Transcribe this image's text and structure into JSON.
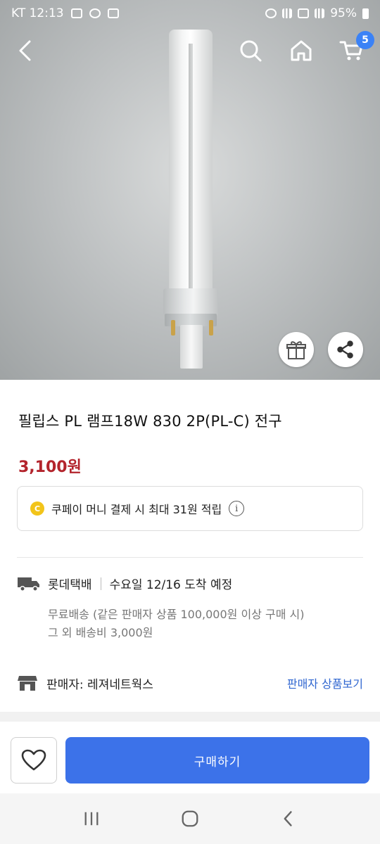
{
  "status_bar": {
    "carrier_time": "KT 12:13",
    "battery": "95%"
  },
  "nav": {
    "cart_count": "5"
  },
  "product": {
    "title": "필립스 PL 램프18W 830 2P(PL-C) 전구",
    "price": "3,100원"
  },
  "point": {
    "coin_label": "C",
    "text": "쿠페이 머니 결제 시 최대 31원 적립",
    "info_glyph": "i"
  },
  "shipping": {
    "carrier": "롯데택배",
    "eta": "수요일 12/16 도착 예정",
    "free_note": "무료배송 (같은 판매자 상품 100,000원 이상 구매 시)",
    "fee_note": "그 외 배송비 3,000원"
  },
  "seller": {
    "label": "판매자: 레져네트웍스",
    "link": "판매자 상품보기"
  },
  "actions": {
    "buy_label": "구매하기"
  },
  "colors": {
    "accent": "#3c72e9",
    "price": "#b3242c",
    "badge": "#3b82f6"
  },
  "icons": [
    "back-icon",
    "search-icon",
    "home-icon",
    "cart-icon",
    "gift-icon",
    "share-icon",
    "truck-icon",
    "store-icon",
    "heart-icon"
  ]
}
